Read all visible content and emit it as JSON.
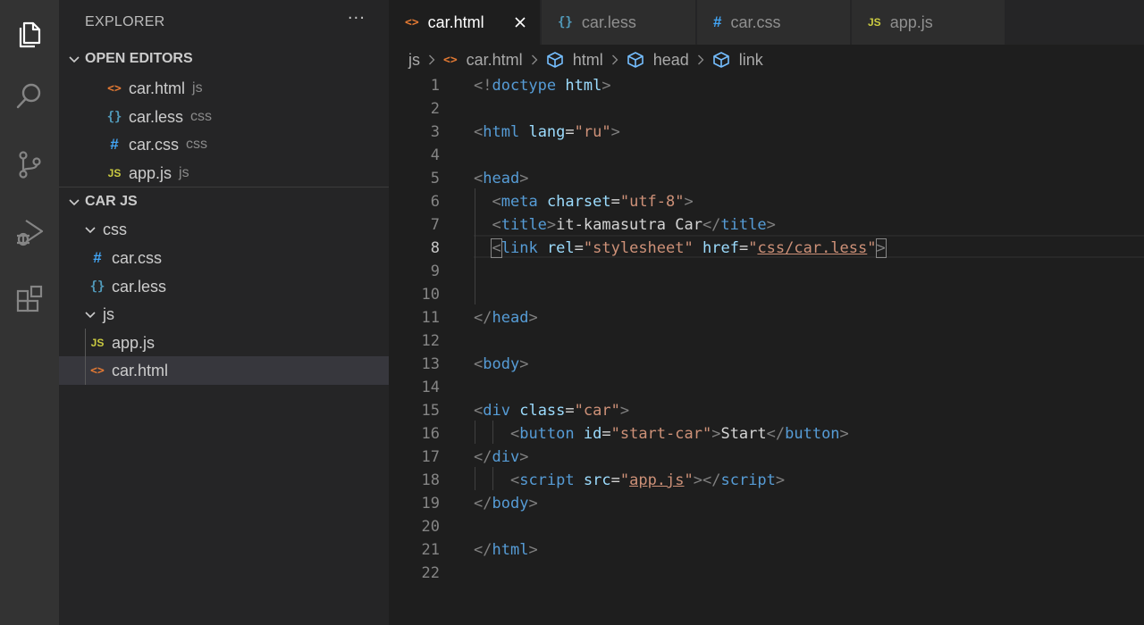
{
  "explorer": {
    "title": "EXPLORER",
    "more": "···",
    "open_editors": {
      "label": "OPEN EDITORS",
      "items": [
        {
          "icon": "<>",
          "name": "car.html",
          "desc": "js"
        },
        {
          "icon": "{}",
          "name": "car.less",
          "desc": "css"
        },
        {
          "icon": "#",
          "name": "car.css",
          "desc": "css"
        },
        {
          "icon": "JS",
          "name": "app.js",
          "desc": "js"
        }
      ]
    },
    "project": {
      "label": "CAR JS",
      "folders": [
        {
          "name": "css",
          "files": [
            {
              "icon": "#",
              "name": "car.css"
            },
            {
              "icon": "{}",
              "name": "car.less"
            }
          ]
        },
        {
          "name": "js",
          "files": [
            {
              "icon": "JS",
              "name": "app.js"
            },
            {
              "icon": "<>",
              "name": "car.html"
            }
          ]
        }
      ]
    }
  },
  "tabs": [
    {
      "icon": "<>",
      "label": "car.html",
      "active": true
    },
    {
      "icon": "{}",
      "label": "car.less"
    },
    {
      "icon": "#",
      "label": "car.css"
    },
    {
      "icon": "JS",
      "label": "app.js"
    }
  ],
  "breadcrumb": [
    "js",
    "car.html",
    "html",
    "head",
    "link"
  ],
  "editor": {
    "current_line": 8,
    "lines": [
      {
        "n": "1",
        "tokens": [
          [
            "p",
            "<!"
          ],
          [
            "t",
            "doctype"
          ],
          [
            "d",
            " "
          ],
          [
            "a",
            "html"
          ],
          [
            "p",
            ">"
          ]
        ]
      },
      {
        "n": "2",
        "tokens": []
      },
      {
        "n": "3",
        "tokens": [
          [
            "p",
            "<"
          ],
          [
            "t",
            "html"
          ],
          [
            "d",
            " "
          ],
          [
            "a",
            "lang"
          ],
          [
            "d",
            "="
          ],
          [
            "s",
            "\"ru\""
          ],
          [
            "p",
            ">"
          ]
        ]
      },
      {
        "n": "4",
        "tokens": []
      },
      {
        "n": "5",
        "tokens": [
          [
            "p",
            "<"
          ],
          [
            "t",
            "head"
          ],
          [
            "p",
            ">"
          ]
        ]
      },
      {
        "n": "6",
        "tokens": [
          [
            "d",
            "  "
          ],
          [
            "p",
            "<"
          ],
          [
            "t",
            "meta"
          ],
          [
            "d",
            " "
          ],
          [
            "a",
            "charset"
          ],
          [
            "d",
            "="
          ],
          [
            "s",
            "\"utf-8\""
          ],
          [
            "p",
            ">"
          ]
        ]
      },
      {
        "n": "7",
        "tokens": [
          [
            "d",
            "  "
          ],
          [
            "p",
            "<"
          ],
          [
            "t",
            "title"
          ],
          [
            "p",
            ">"
          ],
          [
            "d",
            "it-kamasutra Car"
          ],
          [
            "p",
            "</"
          ],
          [
            "t",
            "title"
          ],
          [
            "p",
            ">"
          ]
        ]
      },
      {
        "n": "8",
        "tokens": [
          [
            "d",
            "  "
          ],
          [
            "pb",
            "<"
          ],
          [
            "t",
            "link"
          ],
          [
            "d",
            " "
          ],
          [
            "a",
            "rel"
          ],
          [
            "d",
            "="
          ],
          [
            "s",
            "\"stylesheet\""
          ],
          [
            "d",
            " "
          ],
          [
            "a",
            "href"
          ],
          [
            "d",
            "="
          ],
          [
            "s",
            "\""
          ],
          [
            "su",
            "css/car.less"
          ],
          [
            "s",
            "\""
          ],
          [
            "pb",
            ">"
          ]
        ]
      },
      {
        "n": "9",
        "tokens": []
      },
      {
        "n": "10",
        "tokens": []
      },
      {
        "n": "11",
        "tokens": [
          [
            "p",
            "</"
          ],
          [
            "t",
            "head"
          ],
          [
            "p",
            ">"
          ]
        ]
      },
      {
        "n": "12",
        "tokens": []
      },
      {
        "n": "13",
        "tokens": [
          [
            "p",
            "<"
          ],
          [
            "t",
            "body"
          ],
          [
            "p",
            ">"
          ]
        ]
      },
      {
        "n": "14",
        "tokens": []
      },
      {
        "n": "15",
        "tokens": [
          [
            "p",
            "<"
          ],
          [
            "t",
            "div"
          ],
          [
            "d",
            " "
          ],
          [
            "a",
            "class"
          ],
          [
            "d",
            "="
          ],
          [
            "s",
            "\"car\""
          ],
          [
            "p",
            ">"
          ]
        ]
      },
      {
        "n": "16",
        "tokens": [
          [
            "d",
            "    "
          ],
          [
            "p",
            "<"
          ],
          [
            "t",
            "button"
          ],
          [
            "d",
            " "
          ],
          [
            "a",
            "id"
          ],
          [
            "d",
            "="
          ],
          [
            "s",
            "\"start-car\""
          ],
          [
            "p",
            ">"
          ],
          [
            "d",
            "Start"
          ],
          [
            "p",
            "</"
          ],
          [
            "t",
            "button"
          ],
          [
            "p",
            ">"
          ]
        ]
      },
      {
        "n": "17",
        "tokens": [
          [
            "p",
            "</"
          ],
          [
            "t",
            "div"
          ],
          [
            "p",
            ">"
          ]
        ]
      },
      {
        "n": "18",
        "tokens": [
          [
            "d",
            "    "
          ],
          [
            "p",
            "<"
          ],
          [
            "t",
            "script"
          ],
          [
            "d",
            " "
          ],
          [
            "a",
            "src"
          ],
          [
            "d",
            "="
          ],
          [
            "s",
            "\""
          ],
          [
            "su",
            "app.js"
          ],
          [
            "s",
            "\""
          ],
          [
            "p",
            "></"
          ],
          [
            "t",
            "script"
          ],
          [
            "p",
            ">"
          ]
        ]
      },
      {
        "n": "19",
        "tokens": [
          [
            "p",
            "</"
          ],
          [
            "t",
            "body"
          ],
          [
            "p",
            ">"
          ]
        ]
      },
      {
        "n": "20",
        "tokens": []
      },
      {
        "n": "21",
        "tokens": [
          [
            "p",
            "</"
          ],
          [
            "t",
            "html"
          ],
          [
            "p",
            ">"
          ]
        ]
      },
      {
        "n": "22",
        "tokens": []
      }
    ]
  },
  "colors": {
    "activity_bar": "#333333",
    "sidebar": "#252526",
    "editor": "#1e1e1e",
    "tag": "#569cd6",
    "attribute": "#9cdcfe",
    "string": "#ce9178",
    "html_icon": "#e37933",
    "less_icon": "#519aba",
    "css_icon": "#42a5f5",
    "js_icon": "#cbcb41"
  },
  "icons": {
    "activity": [
      "files-icon",
      "search-icon",
      "source-control-icon",
      "run-debug-icon",
      "extensions-icon"
    ]
  }
}
